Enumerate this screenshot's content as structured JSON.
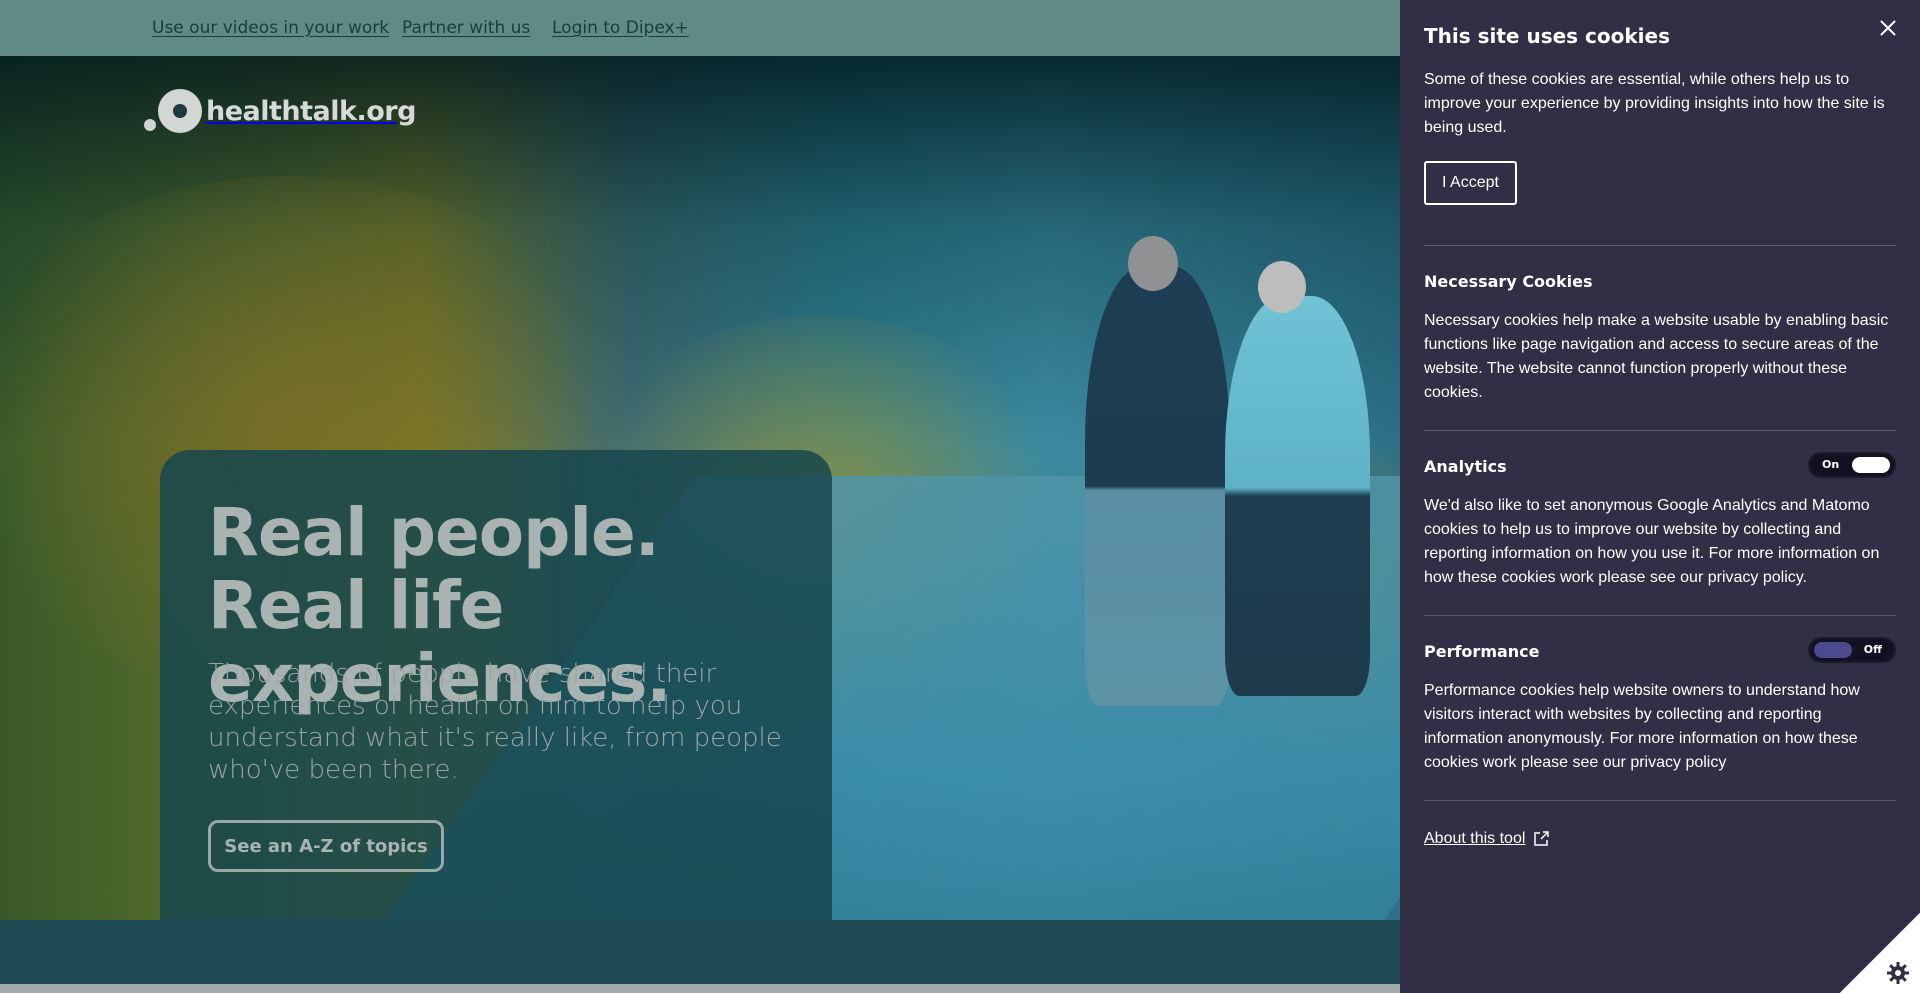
{
  "topbar": {
    "links": [
      "Use our videos in your work",
      "Partner with us",
      "Login to Dipex+"
    ]
  },
  "logo": {
    "text": "healthtalk.org"
  },
  "hero": {
    "heading": "Real people. Real life experiences.",
    "subtext": "Thousands of people have shared their experiences of health on film to help you understand what it's really like, from people who've been there.",
    "cta": "See an A-Z of topics"
  },
  "cookie": {
    "title": "This site uses cookies",
    "intro": "Some of these cookies are essential, while others help us to improve your experience by providing insights into how the site is being used.",
    "accept_label": "I Accept",
    "necessary": {
      "title": "Necessary Cookies",
      "text": "Necessary cookies help make a website usable by enabling basic functions like page navigation and access to secure areas of the website. The website cannot function properly without these cookies."
    },
    "analytics": {
      "title": "Analytics",
      "toggle_label": "On",
      "text": "We'd also like to set anonymous Google Analytics and Matomo cookies to help us to improve our website by collecting and reporting information on how you use it. For more information on how these cookies work please see our privacy policy."
    },
    "performance": {
      "title": "Performance",
      "toggle_label": "Off",
      "text": "Performance cookies help website owners to understand how visitors interact with websites by collecting and reporting information anonymously. For more information on how these cookies work please see our privacy policy"
    },
    "about_label": "About this tool"
  },
  "icons": {
    "close": "close-icon",
    "external": "external-link-icon",
    "gear": "gear-icon"
  },
  "colors": {
    "panel_bg": "#302f45",
    "topbar_bg": "#5f8a86",
    "hero_card": "#16464d"
  }
}
